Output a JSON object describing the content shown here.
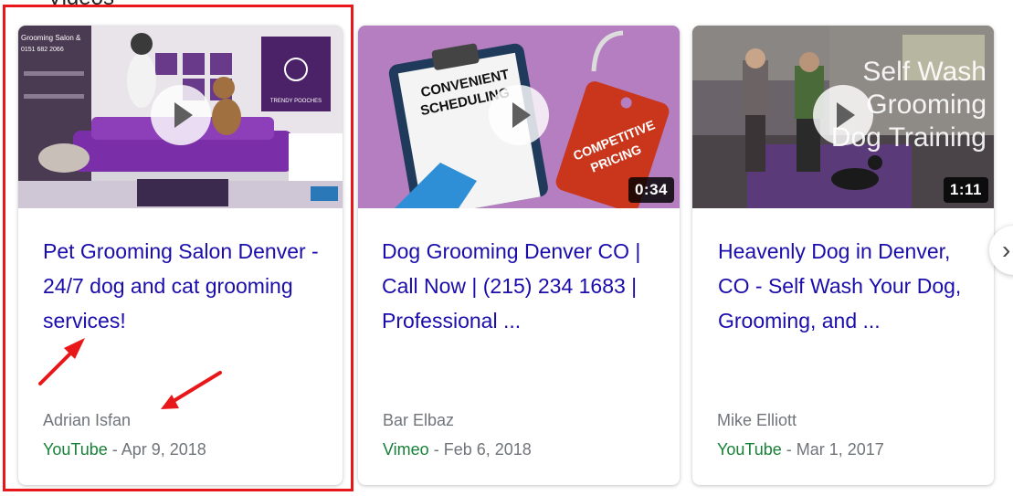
{
  "section": {
    "heading": "Videos"
  },
  "videos": [
    {
      "title": "Pet Grooming Salon Denver - 24/7 dog and cat grooming services!",
      "author": "Adrian Isfan",
      "source": "YouTube",
      "date": "Apr 9, 2018",
      "duration": "",
      "thumb_sign_top": "Grooming Salon &",
      "thumb_sign_phone": "0151 682 2066",
      "thumb_logo": "TRENDY POOCHES"
    },
    {
      "title": "Dog Grooming Denver CO | Call Now | (215) 234 1683 | Professional ...",
      "author": "Bar Elbaz",
      "source": "Vimeo",
      "date": "Feb 6, 2018",
      "duration": "0:34",
      "thumb_text_1": "CONVENIENT",
      "thumb_text_2": "SCHEDULING",
      "thumb_tag_1": "COMPETITIVE",
      "thumb_tag_2": "PRICING"
    },
    {
      "title": "Heavenly Dog in Denver, CO - Self Wash Your Dog, Grooming, and ...",
      "author": "Mike Elliott",
      "source": "YouTube",
      "date": "Mar 1, 2017",
      "duration": "1:11",
      "thumb_overlay_1": "Self Wash",
      "thumb_overlay_2": "Grooming",
      "thumb_overlay_3": "Dog Training"
    }
  ],
  "separator": " - ",
  "next_icon": "chevron-right-icon",
  "annotation_color": "#e8171a"
}
